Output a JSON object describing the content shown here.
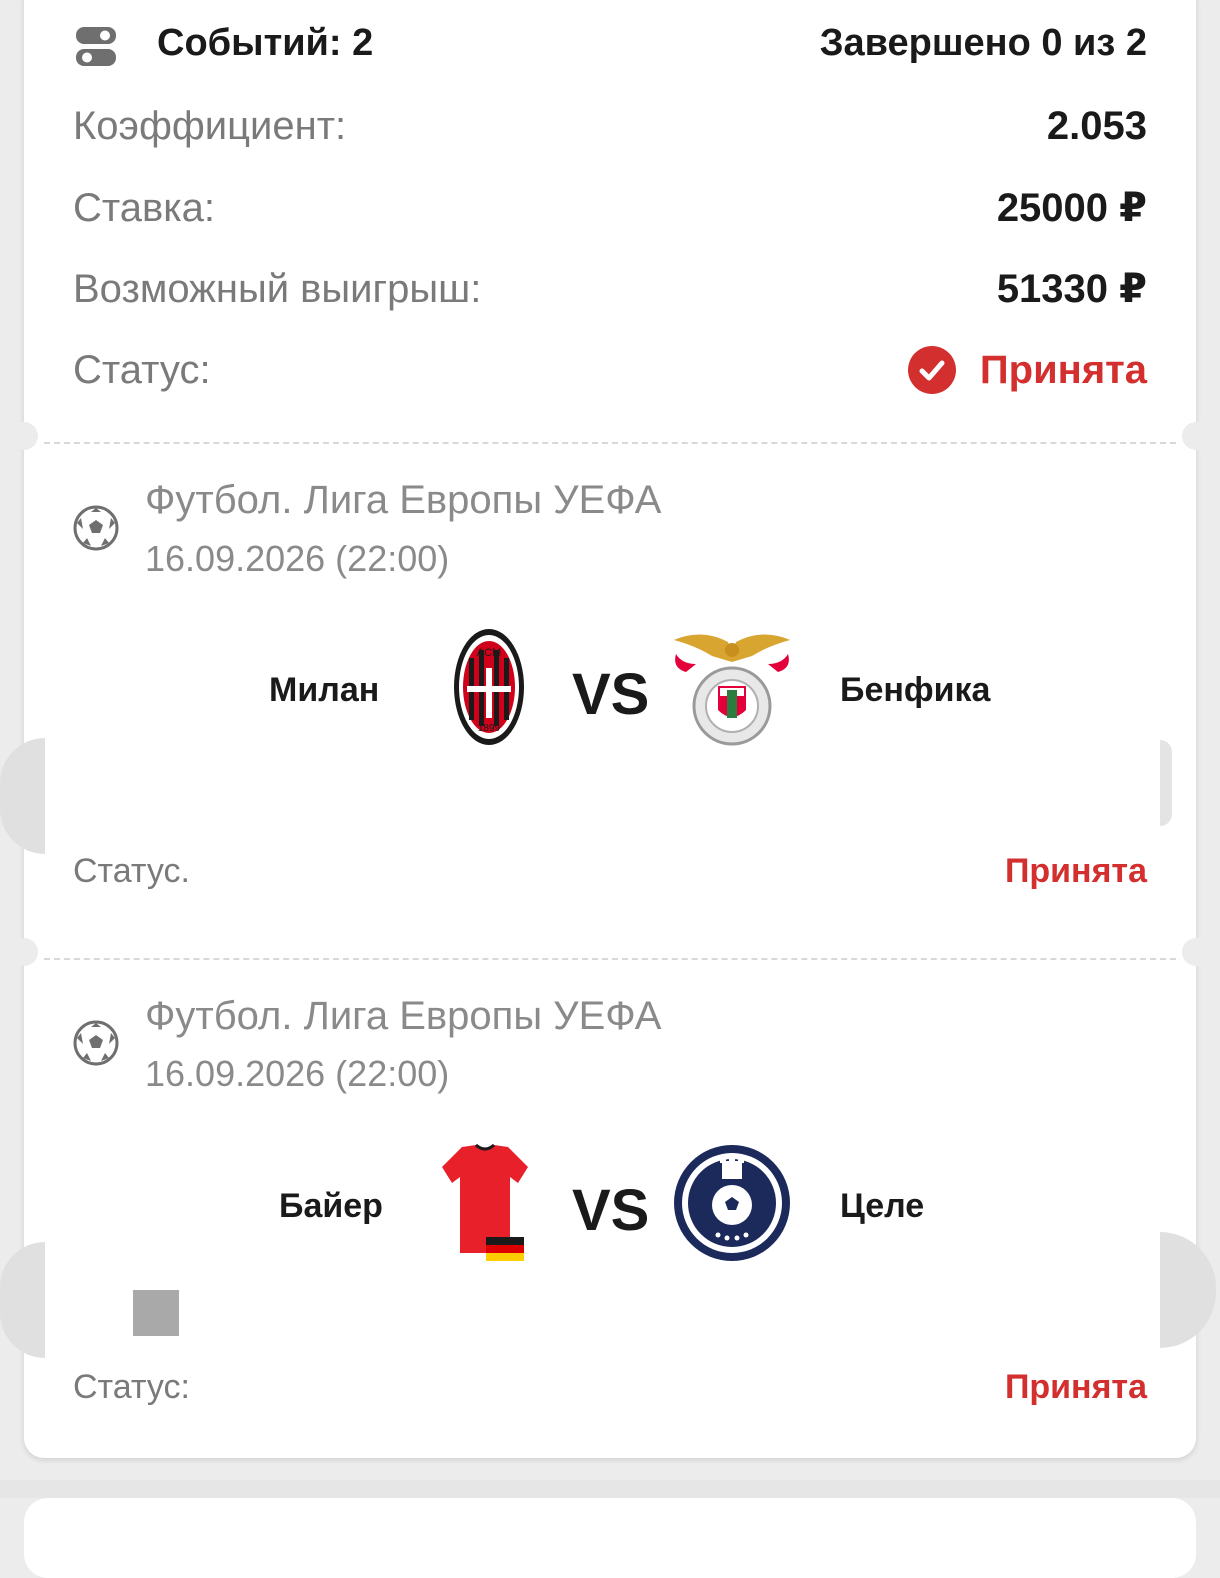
{
  "summary": {
    "events_label": "Событий: 2",
    "completed_label": "Завершено 0 из 2",
    "rows": [
      {
        "label": "Коэффициент:",
        "value": "2.053"
      },
      {
        "label": "Ставка:",
        "value": "25000 ₽"
      },
      {
        "label": "Возможный выигрыш:",
        "value": "51330 ₽"
      }
    ],
    "status_label": "Статус:",
    "status_value": "Принята"
  },
  "events": [
    {
      "league": "Футбол. Лига Европы УЕФА",
      "datetime": "16.09.2026 (22:00)",
      "home": "Милан",
      "away": "Бенфика",
      "vs": "VS",
      "home_logo_text": "ACM",
      "home_logo_year": "1899",
      "status_label": "Статус.",
      "status_value": "Принята"
    },
    {
      "league": "Футбол. Лига Европы УЕФА",
      "datetime": "16.09.2026 (22:00)",
      "home": "Байер",
      "away": "Целе",
      "vs": "VS",
      "away_logo_text": "NOGOMETNI KLUB CELJE",
      "status_label": "Статус:",
      "status_value": "Принята"
    }
  ],
  "colors": {
    "accent_red": "#d32f2f",
    "milan_red": "#d0021b",
    "benfica_red": "#e4003a",
    "celje_blue": "#1b2a5a"
  },
  "icons": {
    "events": "toggle-list-icon",
    "status_ok": "check-circle-icon",
    "sport": "soccer-ball-icon"
  }
}
